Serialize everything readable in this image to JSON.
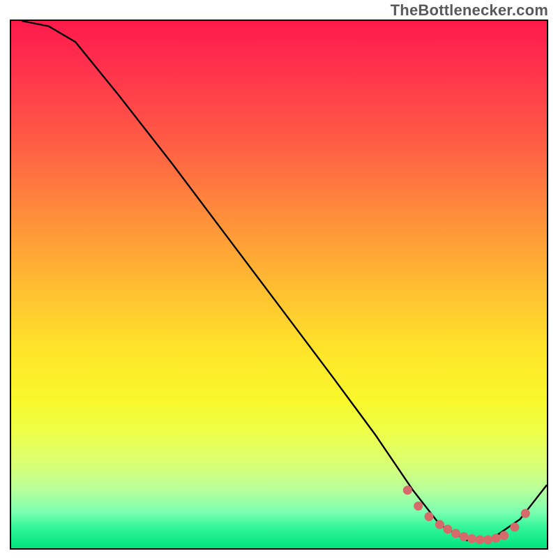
{
  "watermark": "TheBottlenecker.com",
  "chart_data": {
    "type": "line",
    "title": "",
    "xlabel": "",
    "ylabel": "",
    "xlim": [
      0,
      100
    ],
    "ylim": [
      0,
      100
    ],
    "series": [
      {
        "name": "curve",
        "x": [
          2,
          7,
          12,
          20,
          30,
          40,
          50,
          60,
          68,
          75,
          80,
          85,
          90,
          95,
          100
        ],
        "values": [
          100,
          99,
          96,
          86,
          73,
          59.5,
          46,
          32.5,
          21.5,
          11,
          4.5,
          1.5,
          2,
          5.5,
          12
        ]
      }
    ],
    "markers": {
      "name": "highlight-dots",
      "color": "#d46a6a",
      "x": [
        74,
        76,
        78,
        80,
        81.5,
        83,
        84.5,
        86,
        87.5,
        89,
        90.5,
        92,
        94,
        96
      ],
      "values": [
        11.0,
        8.0,
        6.0,
        4.5,
        3.6,
        2.8,
        2.2,
        1.8,
        1.6,
        1.6,
        1.9,
        2.4,
        4.0,
        6.6
      ]
    }
  }
}
